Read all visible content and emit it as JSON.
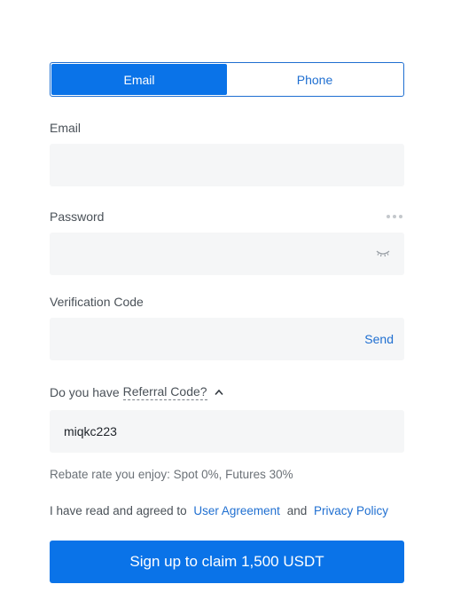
{
  "tabs": [
    {
      "label": "Email",
      "active": true
    },
    {
      "label": "Phone",
      "active": false
    }
  ],
  "email": {
    "label": "Email",
    "value": "",
    "placeholder": ""
  },
  "password": {
    "label": "Password",
    "value": "",
    "placeholder": "",
    "visibility_icon": "eye-closed-icon"
  },
  "verification": {
    "label": "Verification Code",
    "value": "",
    "placeholder": "",
    "send_label": "Send"
  },
  "referral": {
    "question": "Do you have",
    "link_label": "Referral Code?",
    "expanded": true,
    "value": "miqkc223"
  },
  "rebate_text": "Rebate rate you enjoy: Spot 0%, Futures 30%",
  "agreement": {
    "prefix": "I have read and agreed to",
    "user_agreement": "User Agreement",
    "conjunction": "and",
    "privacy_policy": "Privacy Policy"
  },
  "submit_label": "Sign up to claim 1,500 USDT",
  "colors": {
    "accent": "#0a73e8",
    "link": "#1f6fd1",
    "field_bg": "#f5f6f7"
  }
}
